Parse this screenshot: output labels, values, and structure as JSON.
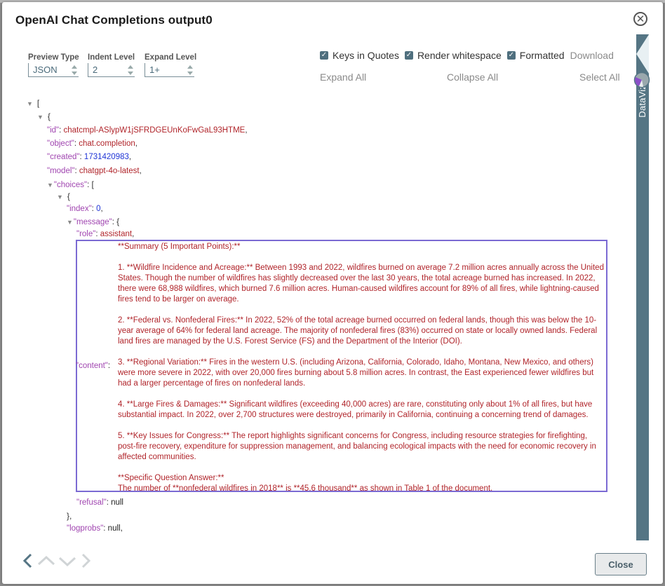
{
  "dialog": {
    "title": "OpenAI Chat Completions output0",
    "close_icon": "close-circle-icon"
  },
  "controls": {
    "preview_type": {
      "label": "Preview Type",
      "value": "JSON"
    },
    "indent_level": {
      "label": "Indent Level",
      "value": "2"
    },
    "expand_level": {
      "label": "Expand Level",
      "value": "1+"
    }
  },
  "options": {
    "keys_in_quotes": {
      "label": "Keys in Quotes",
      "checked": true
    },
    "render_whitespace": {
      "label": "Render whitespace",
      "checked": true
    },
    "formatted": {
      "label": "Formatted",
      "checked": true
    },
    "download": "Download",
    "expand_all": "Expand All",
    "collapse_all": "Collapse All",
    "select_all": "Select All"
  },
  "side_panel": {
    "label": "DataViz"
  },
  "tree": {
    "root_open": "[",
    "obj_open": "{",
    "id": {
      "key": "\"id\"",
      "value": "chatcmpl-ASlypW1jSFRDGEUnKoFwGaL93HTME"
    },
    "object": {
      "key": "\"object\"",
      "value": "chat.completion"
    },
    "created": {
      "key": "\"created\"",
      "value": "1731420983"
    },
    "model": {
      "key": "\"model\"",
      "value": "chatgpt-4o-latest"
    },
    "choices": {
      "key": "\"choices\"",
      "open": "["
    },
    "choice_open": "{",
    "index": {
      "key": "\"index\"",
      "value": "0"
    },
    "message": {
      "key": "\"message\"",
      "open": "{"
    },
    "role": {
      "key": "\"role\"",
      "value": "assistant"
    },
    "content": {
      "key": "\"content\"",
      "value": "**Summary (5 Important Points):**\n\n1. **Wildfire Incidence and Acreage:** Between 1993 and 2022, wildfires burned on average 7.2 million acres annually across the United States. Though the number of wildfires has slightly decreased over the last 30 years, the total acreage burned has increased. In 2022, there were 68,988 wildfires, which burned 7.6 million acres. Human-caused wildfires account for 89% of all fires, while lightning-caused fires tend to be larger on average.\n\n2. **Federal vs. Nonfederal Fires:** In 2022, 52% of the total acreage burned occurred on federal lands, though this was below the 10-year average of 64% for federal land acreage. The majority of nonfederal fires (83%) occurred on state or locally owned lands. Federal land fires are managed by the U.S. Forest Service (FS) and the Department of the Interior (DOI).\n\n3. **Regional Variation:** Fires in the western U.S. (including Arizona, California, Colorado, Idaho, Montana, New Mexico, and others) were more severe in 2022, with over 20,000 fires burning about 5.8 million acres. In contrast, the East experienced fewer wildfires but had a larger percentage of fires on nonfederal lands.\n\n4. **Large Fires & Damages:** Significant wildfires (exceeding 40,000 acres) are rare, constituting only about 1% of all fires, but have substantial impact. In 2022, over 2,700 structures were destroyed, primarily in California, continuing a concerning trend of damages.\n\n5. **Key Issues for Congress:** The report highlights significant concerns for Congress, including resource strategies for firefighting, post-fire recovery, expenditure for suppression management, and balancing ecological impacts with the need for economic recovery in affected communities.\n\n**Specific Question Answer:**\nThe number of **nonfederal wildfires in 2018** is **45.6 thousand** as shown in Table 1 of the document."
    },
    "refusal": {
      "key": "\"refusal\"",
      "value": "null"
    },
    "message_close": "},",
    "logprobs": {
      "key": "\"logprobs\"",
      "value": "null,"
    }
  },
  "footer": {
    "nav_icons": [
      "chevron-left-icon",
      "chevron-up-icon",
      "chevron-down-icon",
      "chevron-right-icon"
    ],
    "close_button": "Close"
  },
  "colors": {
    "key": "#a045b0",
    "string": "#b0242a",
    "number": "#2035d6",
    "highlight_border": "#7b6ad3",
    "panel": "#557584"
  }
}
